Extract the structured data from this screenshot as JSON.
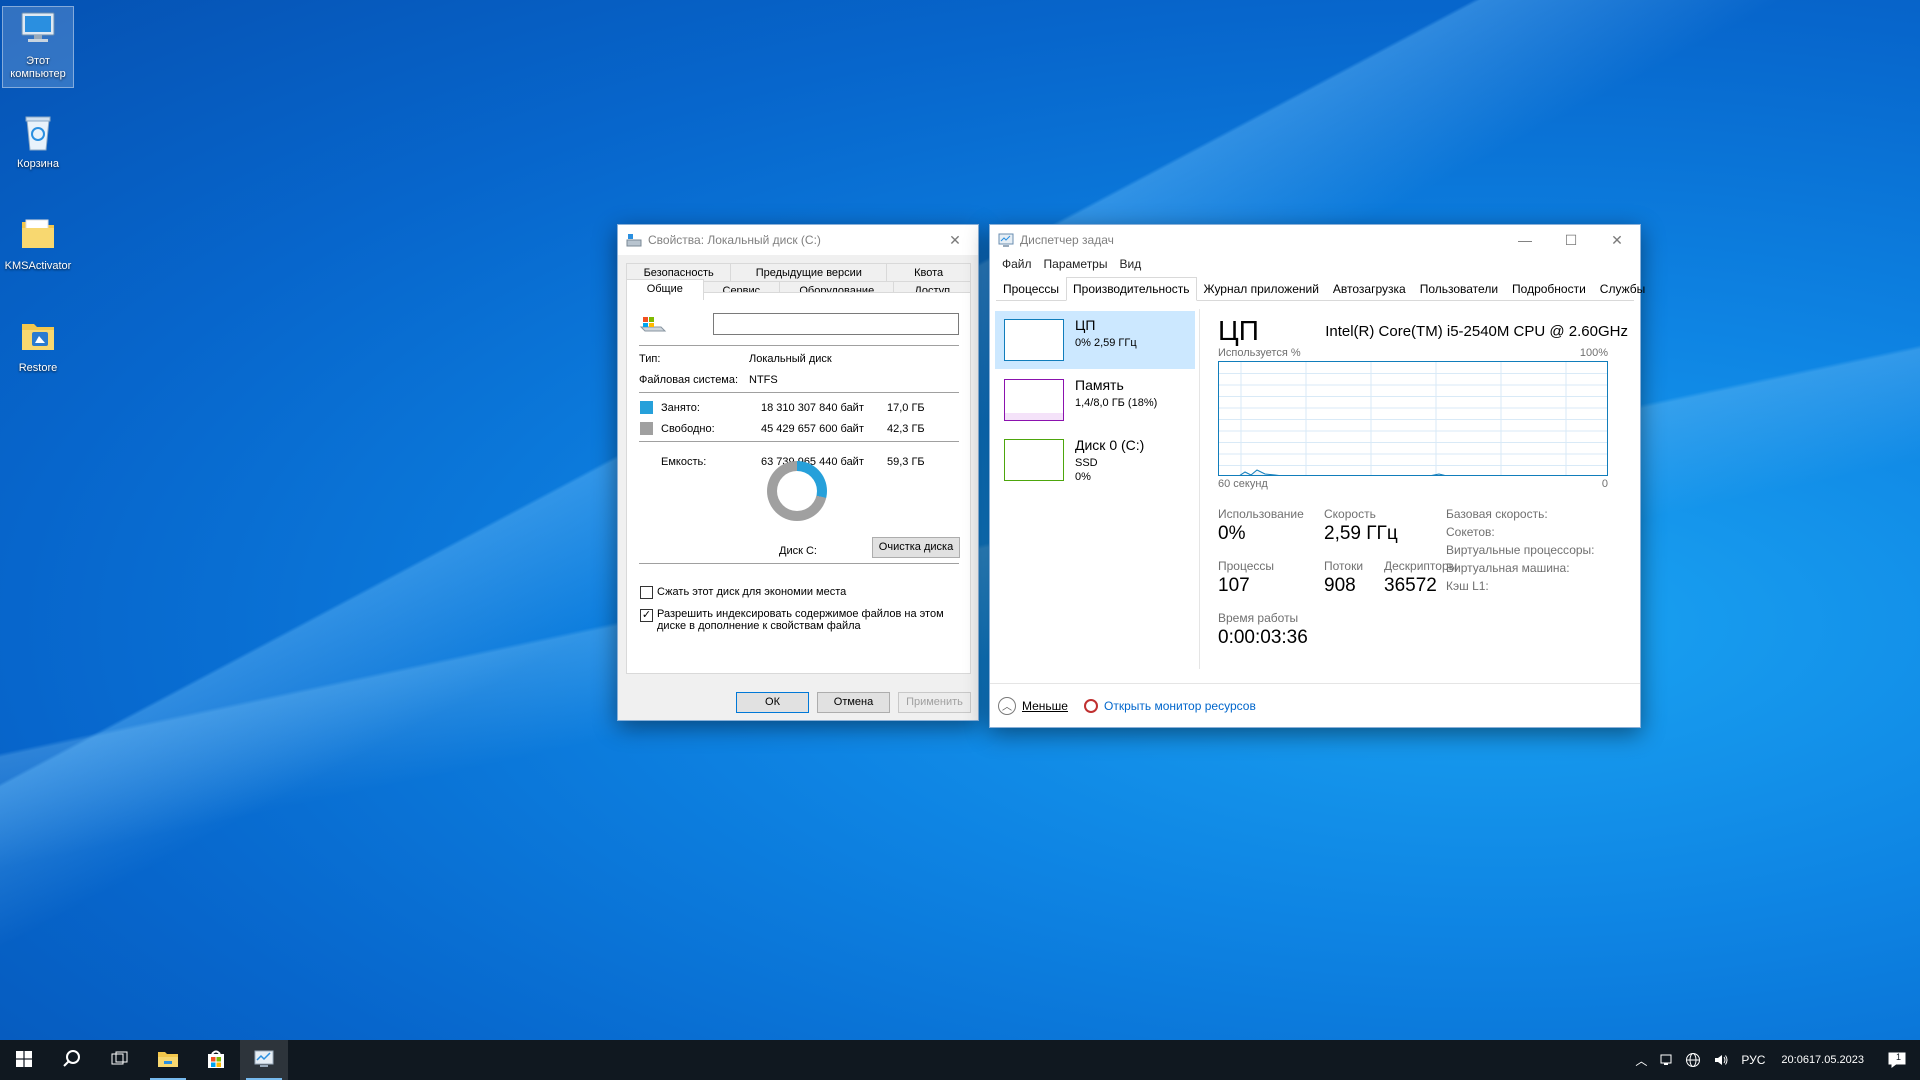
{
  "desktop": {
    "icons": [
      {
        "label": "Этот компьютер",
        "icon": "computer-icon"
      },
      {
        "label": "Корзина",
        "icon": "recycle-bin-icon"
      },
      {
        "label": "KMSActivator",
        "icon": "folder-icon"
      },
      {
        "label": "Restore",
        "icon": "folder-icon"
      }
    ]
  },
  "props": {
    "title": "Свойства: Локальный диск (C:)",
    "tabs_row1": [
      "Безопасность",
      "Предыдущие версии",
      "Квота"
    ],
    "tabs_row2": [
      "Общие",
      "Сервис",
      "Оборудование",
      "Доступ"
    ],
    "active_tab": "Общие",
    "name_value": "",
    "type_label": "Тип:",
    "type_value": "Локальный диск",
    "fs_label": "Файловая система:",
    "fs_value": "NTFS",
    "used_label": "Занято:",
    "used_bytes": "18 310 307 840 байт",
    "used_gb": "17,0 ГБ",
    "free_label": "Свободно:",
    "free_bytes": "45 429 657 600 байт",
    "free_gb": "42,3 ГБ",
    "capacity_label": "Емкость:",
    "capacity_bytes": "63 739 965 440 байт",
    "capacity_gb": "59,3 ГБ",
    "used_fraction": 0.287,
    "disk_label": "Диск C:",
    "cleanup_button": "Очистка диска",
    "compress_label": "Сжать этот диск для экономии места",
    "compress_checked": false,
    "index_label_1": "Разрешить индексировать содержимое файлов на этом",
    "index_label_2": "диске в дополнение к свойствам файла",
    "index_checked": true,
    "ok_button": "ОК",
    "cancel_button": "Отмена",
    "apply_button": "Применить",
    "colors": {
      "used": "#26a0da",
      "free": "#a0a0a0"
    }
  },
  "taskmgr": {
    "title": "Диспетчер задач",
    "menu": [
      "Файл",
      "Параметры",
      "Вид"
    ],
    "tabs": [
      "Процессы",
      "Производительность",
      "Журнал приложений",
      "Автозагрузка",
      "Пользователи",
      "Подробности",
      "Службы"
    ],
    "active_tab": "Производительность",
    "resources": [
      {
        "title": "ЦП",
        "sub1": "0% 2,59 ГГц",
        "sub2": "",
        "color": "#117dbb"
      },
      {
        "title": "Память",
        "sub1": "1,4/8,0 ГБ (18%)",
        "sub2": "",
        "color": "#8b12ae"
      },
      {
        "title": "Диск 0 (C:)",
        "sub1": "SSD",
        "sub2": "0%",
        "color": "#4da60c"
      }
    ],
    "main_title": "ЦП",
    "cpu_name": "Intel(R) Core(TM) i5-2540M CPU @ 2.60GHz",
    "graph_label_top_left": "Используется %",
    "graph_label_top_right": "100%",
    "graph_label_bottom_left": "60 секунд",
    "graph_label_bottom_right": "0",
    "usage_label": "Использование",
    "usage_value": "0%",
    "speed_label": "Скорость",
    "speed_value": "2,59 ГГц",
    "processes_label": "Процессы",
    "processes_value": "107",
    "threads_label": "Потоки",
    "threads_value": "908",
    "handles_label": "Дескрипторы",
    "handles_value": "36572",
    "uptime_label": "Время работы",
    "uptime_value": "0:00:03:36",
    "specs": [
      "Базовая скорость:",
      "Сокетов:",
      "Виртуальные процессоры:",
      "Виртуальная машина:",
      "Кэш L1:"
    ],
    "footer_less": "Меньше",
    "footer_monitor": "Открыть монитор ресурсов"
  },
  "taskbar": {
    "lang": "РУС",
    "time": "20:06",
    "date": "17.05.2023",
    "notification_count": "1"
  }
}
